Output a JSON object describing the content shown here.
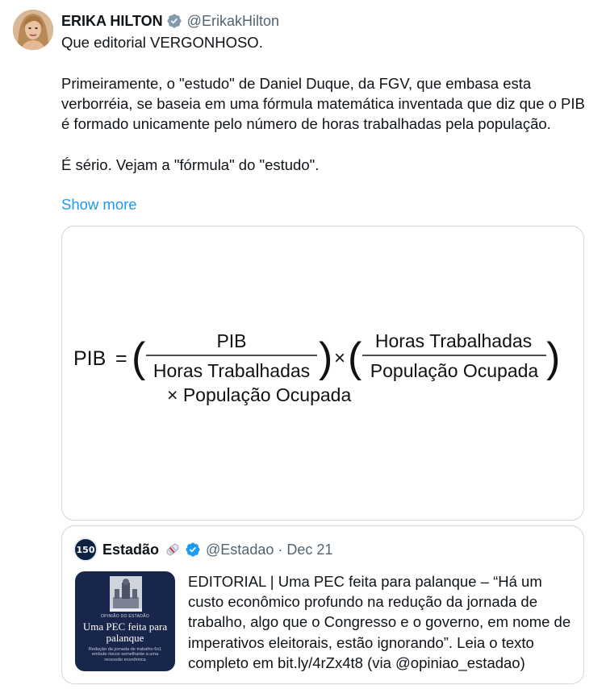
{
  "tweet": {
    "author_name": "ERIKA HILTON",
    "handle": "@ErikakHilton",
    "paragraphs": [
      "Que editorial VERGONHOSO.",
      "Primeiramente, o \"estudo\" de Daniel Duque, da FGV, que embasa esta verborréia, se baseia em uma fórmula matemática inventada que diz que o PIB é formado unicamente pelo número de horas trabalhadas pela população.",
      "É sério. Vejam a \"fórmula\" do \"estudo\"."
    ],
    "show_more_label": "Show more"
  },
  "formula_image": {
    "lhs": "PIB",
    "equals": "=",
    "frac1_num": "PIB",
    "frac1_den": "Horas Trabalhadas",
    "times": "×",
    "frac2_num": "Horas Trabalhadas",
    "frac2_den": "População Ocupada",
    "line2": "× População Ocupada",
    "open_paren": "(",
    "close_paren": ")"
  },
  "quote": {
    "author_name": "Estadão",
    "avatar_text": "150",
    "emoji_icon": "newspaper-roll-icon",
    "handle": "@Estadao",
    "separator": "·",
    "date": "Dec 21",
    "text": "EDITORIAL | Uma PEC feita para palanque – “Há um custo econômico profundo na redução da jornada de trabalho, algo que o Congresso e o governo, em nome de imperativos eleitorais, estão ignorando”. Leia o texto completo em bit.ly/4rZx4t8 (via @opiniao_estadao)",
    "thumbnail": {
      "kicker": "OPINIÃO DO ESTADÃO",
      "title": "Uma PEC feita para palanque",
      "subtitle": "Redução da jornada de trabalho 6x1 embute riscos semelhante a uma recessão econômica"
    }
  },
  "colors": {
    "accent": "#1d9bf0",
    "text": "#0f1419",
    "muted": "#536471",
    "border": "#cfd9de",
    "verified": "#829aab",
    "estadao_navy": "#17264a"
  }
}
